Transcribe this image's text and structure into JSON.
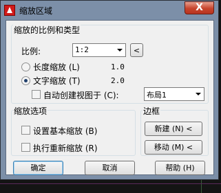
{
  "window": {
    "title": "缩放区域",
    "close_glyph": "X"
  },
  "ratio_group": {
    "label": "缩放的比例和类型",
    "ratio_label": "比例:",
    "ratio_value": "1:2",
    "pick_glyph": "<",
    "length_radio": {
      "label": "长度缩放 (L)",
      "value": "1.0",
      "selected": false
    },
    "text_radio": {
      "label": "文字缩放 (T)",
      "value": "2.0",
      "selected": true
    },
    "auto_view_check": {
      "label": "自动创建视图于 (C):",
      "checked": false
    },
    "layout_value": "布局1"
  },
  "options_group": {
    "label": "缩放选项",
    "set_base_check": {
      "label": "设置基本缩放 (B)",
      "checked": false
    },
    "rescale_check": {
      "label": "执行重新缩放 (R)",
      "checked": false
    }
  },
  "border_group": {
    "label": "边框",
    "new_button": "新建 (N) <",
    "move_button": "移动 (M) <"
  },
  "footer": {
    "ok_button": "确定",
    "cancel_button": "取消",
    "help_button": "帮助 (H)"
  },
  "colors": {
    "frame": "#7c8fa8",
    "close": "#c7442c",
    "client": "#f0f0f0",
    "background": "#141414"
  }
}
